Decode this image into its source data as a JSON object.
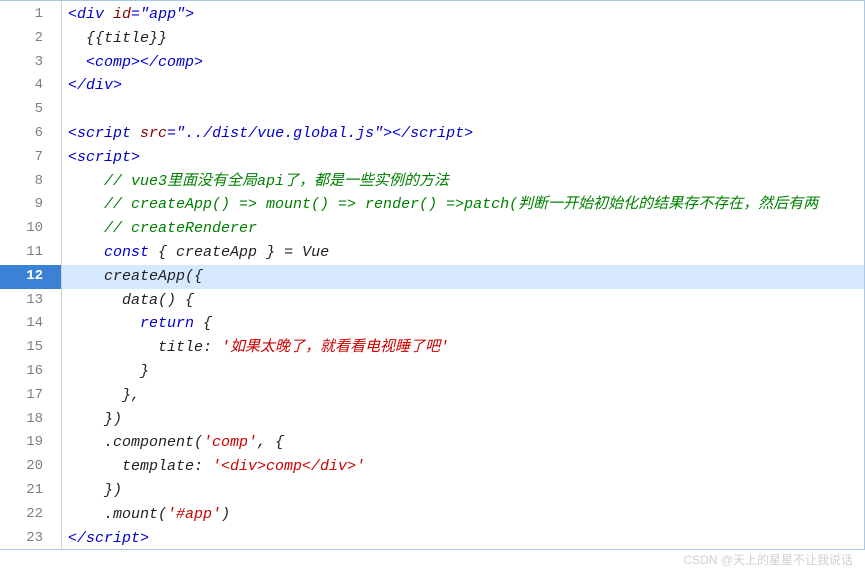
{
  "editor": {
    "highlightedLine": 12,
    "lines": [
      {
        "n": 1,
        "tokens": [
          [
            "t-tag",
            "<div"
          ],
          [
            "t-text",
            " "
          ],
          [
            "t-attr",
            "id"
          ],
          [
            "t-tag",
            "="
          ],
          [
            "t-str",
            "\"app\""
          ],
          [
            "t-tag",
            ">"
          ]
        ]
      },
      {
        "n": 2,
        "tokens": [
          [
            "t-text",
            "  {{title}}"
          ]
        ]
      },
      {
        "n": 3,
        "tokens": [
          [
            "t-text",
            "  "
          ],
          [
            "t-tag",
            "<comp></comp>"
          ]
        ]
      },
      {
        "n": 4,
        "tokens": [
          [
            "t-tag",
            "</div>"
          ]
        ]
      },
      {
        "n": 5,
        "tokens": [
          [
            "t-text",
            ""
          ]
        ]
      },
      {
        "n": 6,
        "tokens": [
          [
            "t-tag",
            "<script"
          ],
          [
            "t-text",
            " "
          ],
          [
            "t-attr",
            "src"
          ],
          [
            "t-tag",
            "="
          ],
          [
            "t-str",
            "\"../dist/vue.global.js\""
          ],
          [
            "t-tag",
            "></script>"
          ]
        ]
      },
      {
        "n": 7,
        "tokens": [
          [
            "t-tag",
            "<script>"
          ]
        ]
      },
      {
        "n": 8,
        "tokens": [
          [
            "t-text",
            "    "
          ],
          [
            "t-comment",
            "// vue3里面没有全局api了，都是一些实例的方法"
          ]
        ]
      },
      {
        "n": 9,
        "tokens": [
          [
            "t-text",
            "    "
          ],
          [
            "t-comment",
            "// createApp() => mount() => render() =>patch(判断一开始初始化的结果存不存在，然后有两"
          ]
        ]
      },
      {
        "n": 10,
        "tokens": [
          [
            "t-text",
            "    "
          ],
          [
            "t-comment",
            "// createRenderer"
          ]
        ]
      },
      {
        "n": 11,
        "tokens": [
          [
            "t-text",
            "    "
          ],
          [
            "t-keyword",
            "const"
          ],
          [
            "t-text",
            " { "
          ],
          [
            "t-func",
            "createApp"
          ],
          [
            "t-text",
            " } = Vue"
          ]
        ]
      },
      {
        "n": 12,
        "tokens": [
          [
            "t-text",
            "    "
          ],
          [
            "t-func",
            "createApp"
          ],
          [
            "t-text",
            "({"
          ]
        ]
      },
      {
        "n": 13,
        "tokens": [
          [
            "t-text",
            "      "
          ],
          [
            "t-func",
            "data"
          ],
          [
            "t-text",
            "() {"
          ]
        ]
      },
      {
        "n": 14,
        "tokens": [
          [
            "t-text",
            "        "
          ],
          [
            "t-keyword",
            "return"
          ],
          [
            "t-text",
            " {"
          ]
        ]
      },
      {
        "n": 15,
        "tokens": [
          [
            "t-text",
            "          title: "
          ],
          [
            "t-strval",
            "'如果太晚了，就看看电视睡了吧'"
          ]
        ]
      },
      {
        "n": 16,
        "tokens": [
          [
            "t-text",
            "        }"
          ]
        ]
      },
      {
        "n": 17,
        "tokens": [
          [
            "t-text",
            "      },"
          ]
        ]
      },
      {
        "n": 18,
        "tokens": [
          [
            "t-text",
            "    })"
          ]
        ]
      },
      {
        "n": 19,
        "tokens": [
          [
            "t-text",
            "    ."
          ],
          [
            "t-func",
            "component"
          ],
          [
            "t-text",
            "("
          ],
          [
            "t-strval",
            "'comp'"
          ],
          [
            "t-text",
            ", {"
          ]
        ]
      },
      {
        "n": 20,
        "tokens": [
          [
            "t-text",
            "      template: "
          ],
          [
            "t-strval",
            "'<div>comp</div>'"
          ]
        ]
      },
      {
        "n": 21,
        "tokens": [
          [
            "t-text",
            "    })"
          ]
        ]
      },
      {
        "n": 22,
        "tokens": [
          [
            "t-text",
            "    ."
          ],
          [
            "t-func",
            "mount"
          ],
          [
            "t-text",
            "("
          ],
          [
            "t-strval",
            "'#app'"
          ],
          [
            "t-text",
            ")"
          ]
        ]
      },
      {
        "n": 23,
        "tokens": [
          [
            "t-tag",
            "</script>"
          ]
        ]
      }
    ]
  },
  "watermark": "CSDN @天上的星星不让我说话"
}
